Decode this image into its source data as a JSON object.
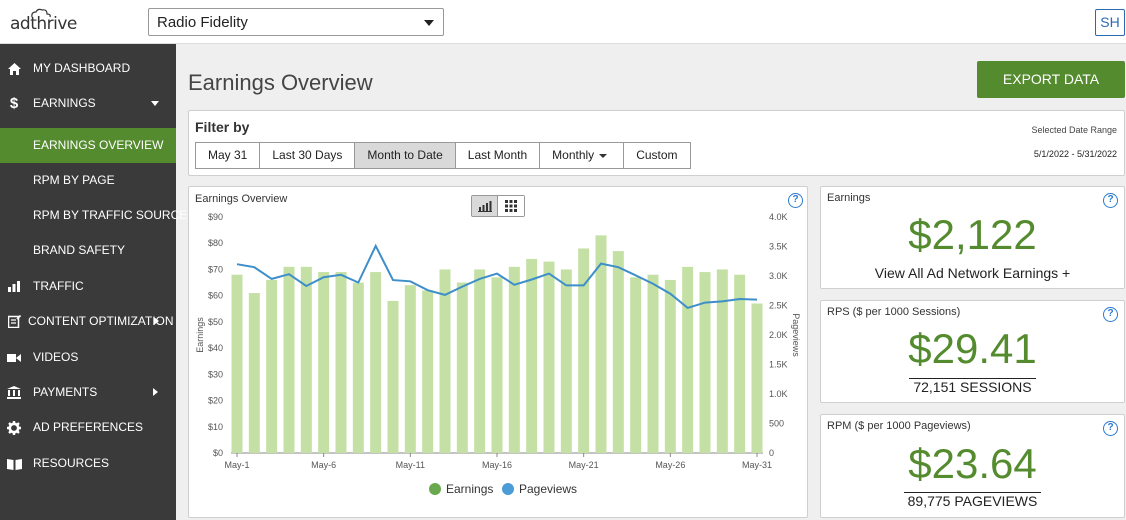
{
  "header": {
    "logo_text": "adthrive",
    "site_selected": "Radio Fidelity",
    "user_initials": "SH"
  },
  "sidebar": {
    "items": [
      {
        "label": "MY DASHBOARD",
        "icon": "home-icon"
      },
      {
        "label": "EARNINGS",
        "icon": "dollar-icon"
      },
      {
        "label": "EARNINGS OVERVIEW",
        "icon": ""
      },
      {
        "label": "RPM BY PAGE",
        "icon": ""
      },
      {
        "label": "RPM BY TRAFFIC SOURCE",
        "icon": ""
      },
      {
        "label": "BRAND SAFETY",
        "icon": ""
      },
      {
        "label": "TRAFFIC",
        "icon": "bar-chart-icon"
      },
      {
        "label": "CONTENT OPTIMIZATION",
        "icon": "content-edit-icon"
      },
      {
        "label": "VIDEOS",
        "icon": "video-camera-icon"
      },
      {
        "label": "PAYMENTS",
        "icon": "bank-icon"
      },
      {
        "label": "AD PREFERENCES",
        "icon": "gear-icon"
      },
      {
        "label": "RESOURCES",
        "icon": "book-icon"
      }
    ]
  },
  "main": {
    "title": "Earnings Overview",
    "export_label": "EXPORT DATA",
    "filter": {
      "title": "Filter by",
      "buttons": [
        "May 31",
        "Last 30 Days",
        "Month to Date",
        "Last Month",
        "Monthly",
        "Custom"
      ],
      "active": "Month to Date",
      "date_label": "Selected Date Range",
      "date_range": "5/1/2022 - 5/31/2022"
    },
    "stats": {
      "earnings": {
        "title": "Earnings",
        "value": "$2,122",
        "sub": "View All Ad Network Earnings +"
      },
      "rps": {
        "title": "RPS ($ per 1000 Sessions)",
        "value": "$29.41",
        "sub": "72,151 SESSIONS"
      },
      "rpm": {
        "title": "RPM ($ per 1000 Pageviews)",
        "value": "$23.64",
        "sub": "89,775 PAGEVIEWS"
      }
    }
  },
  "colors": {
    "accent": "#558b2f",
    "bar": "#c5e0a5",
    "line": "#3d8ec9",
    "legend_earnings": "#6aa84f",
    "legend_pageviews": "#4a9bd6"
  },
  "chart_data": {
    "type": "bar",
    "title": "Earnings Overview",
    "ylabel": "Earnings",
    "y2label": "Pageviews",
    "x": [
      "May-1",
      "May-2",
      "May-3",
      "May-4",
      "May-5",
      "May-6",
      "May-7",
      "May-8",
      "May-9",
      "May-10",
      "May-11",
      "May-12",
      "May-13",
      "May-14",
      "May-15",
      "May-16",
      "May-17",
      "May-18",
      "May-19",
      "May-20",
      "May-21",
      "May-22",
      "May-23",
      "May-24",
      "May-25",
      "May-26",
      "May-27",
      "May-28",
      "May-29",
      "May-30",
      "May-31"
    ],
    "xtick_labels": [
      "May-1",
      "May-6",
      "May-11",
      "May-16",
      "May-21",
      "May-26",
      "May-31"
    ],
    "ylim": [
      0,
      90
    ],
    "yticks": [
      "$0",
      "$10",
      "$20",
      "$30",
      "$40",
      "$50",
      "$60",
      "$70",
      "$80",
      "$90"
    ],
    "y2lim": [
      0,
      4000
    ],
    "y2ticks": [
      "0",
      "500",
      "1.0K",
      "1.5K",
      "2.0K",
      "2.5K",
      "3.0K",
      "3.5K",
      "4.0K"
    ],
    "series": [
      {
        "name": "Earnings",
        "axis": "left",
        "type": "bar",
        "values": [
          68,
          61,
          66,
          71,
          71,
          69,
          69,
          65,
          69,
          58,
          64,
          62,
          70,
          65,
          70,
          67,
          71,
          74,
          73,
          70,
          78,
          83,
          77,
          67,
          68,
          66,
          71,
          69,
          70,
          68,
          57
        ]
      },
      {
        "name": "Pageviews",
        "axis": "right",
        "type": "line",
        "values": [
          3200,
          3150,
          2950,
          3030,
          2830,
          2980,
          3020,
          2890,
          3510,
          2930,
          2910,
          2760,
          2680,
          2820,
          2950,
          3040,
          2850,
          2940,
          3040,
          2840,
          2840,
          3210,
          3150,
          3010,
          2870,
          2700,
          2460,
          2550,
          2570,
          2610,
          2600
        ]
      }
    ],
    "legend": [
      "Earnings",
      "Pageviews"
    ],
    "legend_position": "bottom"
  }
}
